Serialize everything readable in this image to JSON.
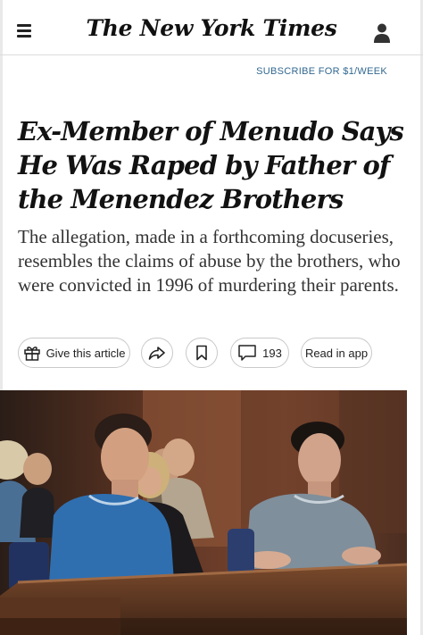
{
  "header": {
    "logo_text": "The New York Times",
    "menu_icon": "hamburger-menu-icon",
    "account_icon": "person-account-icon"
  },
  "subscribe": {
    "label": "SUBSCRIBE FOR $1/WEEK"
  },
  "article": {
    "headline": "Ex-Member of Menudo Says He Was Raped by Father of the Menendez Brothers",
    "summary": "The allegation, made in a forthcoming docuseries, resembles the claims of abuse by the brothers, who were convicted in 1996 of murdering their parents."
  },
  "actions": {
    "gift_label": "Give this article",
    "gift_icon": "gift-icon",
    "share_icon": "share-arrow-icon",
    "bookmark_icon": "bookmark-icon",
    "comments_icon": "comment-bubble-icon",
    "comments_count": "193",
    "read_in_app_label": "Read in app"
  },
  "colors": {
    "subscribe_link": "#326891",
    "text": "#121212",
    "border": "#c9c9c9"
  }
}
